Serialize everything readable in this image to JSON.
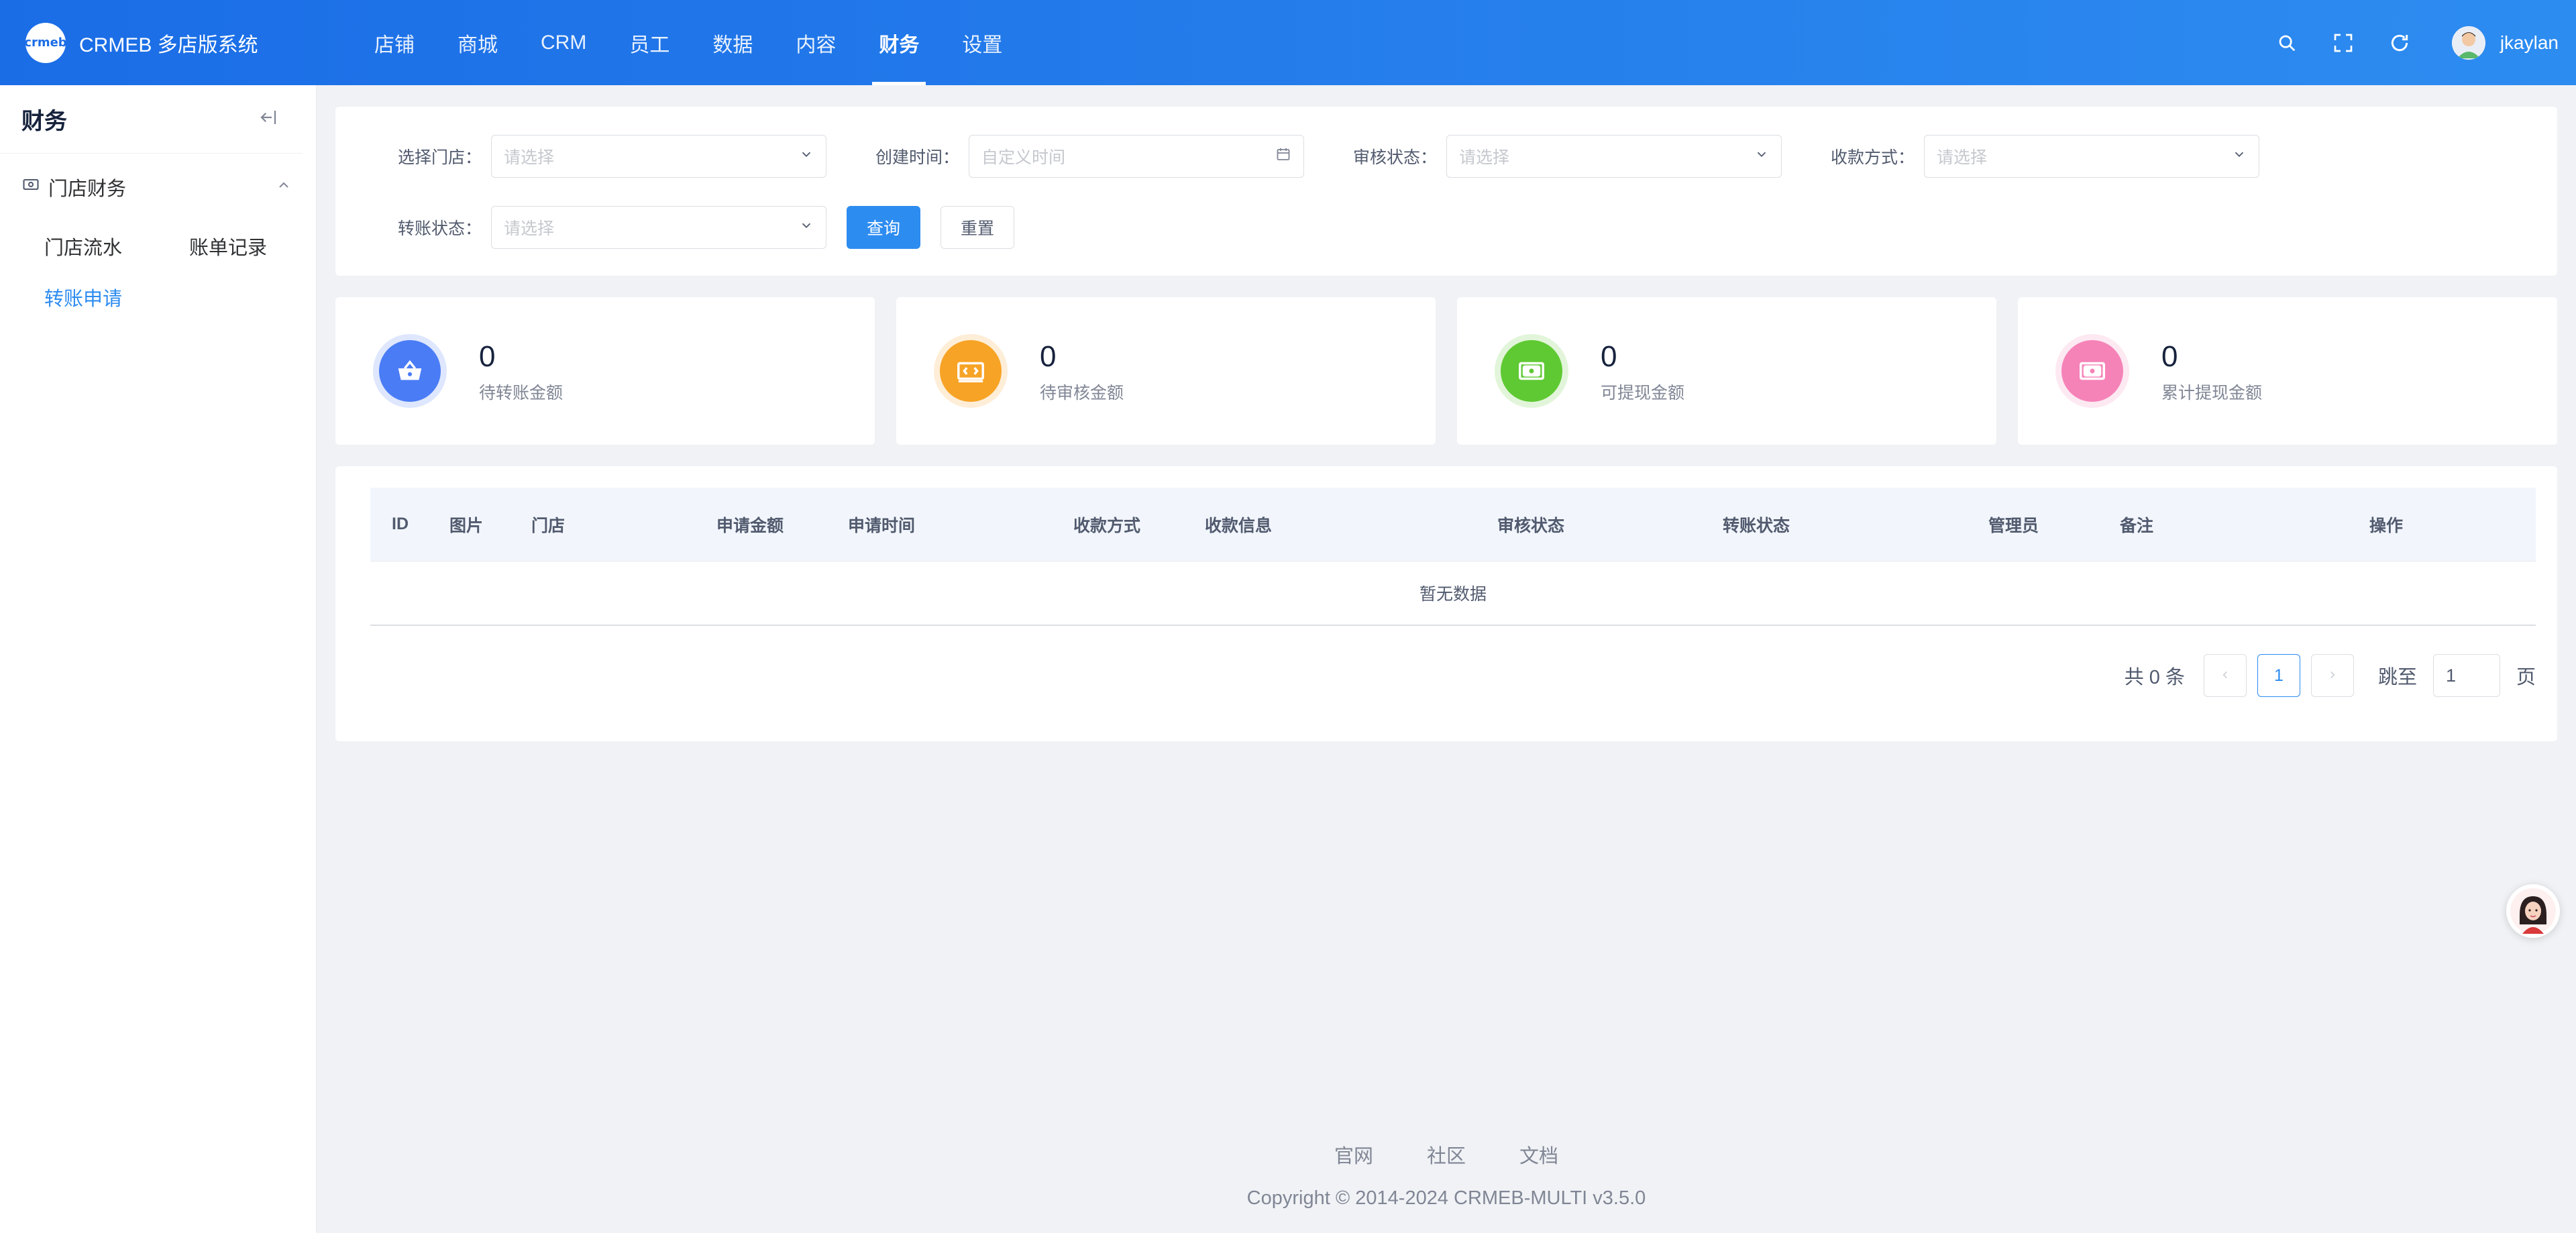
{
  "app": {
    "logo_text": "crmeb",
    "title": "CRMEB 多店版系统"
  },
  "nav": {
    "items": [
      {
        "label": "店铺",
        "active": false
      },
      {
        "label": "商城",
        "active": false
      },
      {
        "label": "CRM",
        "active": false
      },
      {
        "label": "员工",
        "active": false
      },
      {
        "label": "数据",
        "active": false
      },
      {
        "label": "内容",
        "active": false
      },
      {
        "label": "财务",
        "active": true
      },
      {
        "label": "设置",
        "active": false
      }
    ]
  },
  "user": {
    "name": "jkaylan"
  },
  "header_icons": [
    "search-icon",
    "fullscreen-icon",
    "refresh-icon"
  ],
  "sidebar": {
    "title": "财务",
    "group": {
      "label": "门店财务",
      "expanded": true
    },
    "items": [
      {
        "label": "门店流水",
        "active": false
      },
      {
        "label": "账单记录",
        "active": false
      },
      {
        "label": "转账申请",
        "active": true
      }
    ]
  },
  "filters": {
    "store": {
      "label": "选择门店：",
      "placeholder": "请选择"
    },
    "created_time": {
      "label": "创建时间：",
      "placeholder": "自定义时间"
    },
    "review_status": {
      "label": "审核状态：",
      "placeholder": "请选择"
    },
    "payment_method": {
      "label": "收款方式：",
      "placeholder": "请选择"
    },
    "transfer_status": {
      "label": "转账状态：",
      "placeholder": "请选择"
    },
    "query_label": "查询",
    "reset_label": "重置"
  },
  "stats": [
    {
      "value": "0",
      "label": "待转账金额",
      "color": "#4a7cf6",
      "icon": "basket-icon"
    },
    {
      "value": "0",
      "label": "待审核金额",
      "color": "#f7a325",
      "icon": "money-icon"
    },
    {
      "value": "0",
      "label": "可提现金额",
      "color": "#5fc933",
      "icon": "cash-icon"
    },
    {
      "value": "0",
      "label": "累计提现金额",
      "color": "#f583b8",
      "icon": "wallet-icon"
    }
  ],
  "table": {
    "columns": [
      "ID",
      "图片",
      "门店",
      "申请金额",
      "申请时间",
      "收款方式",
      "收款信息",
      "审核状态",
      "转账状态",
      "管理员",
      "备注",
      "操作"
    ],
    "empty_text": "暂无数据"
  },
  "pagination": {
    "total_text": "共 0 条",
    "current_page": "1",
    "jump_label": "跳至",
    "jump_value": "1",
    "page_suffix": "页"
  },
  "footer": {
    "links": [
      "官网",
      "社区",
      "文档"
    ],
    "copyright": "Copyright © 2014-2024 CRMEB-MULTI v3.5.0"
  },
  "colors": {
    "primary": "#2d8cf0",
    "header_start": "#1b6de6",
    "header_end": "#2d8cf0"
  }
}
